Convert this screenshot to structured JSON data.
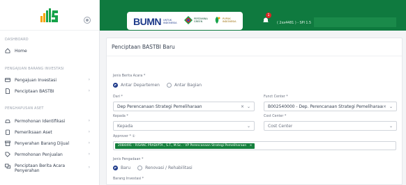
{
  "sidebar": {
    "sections": [
      {
        "label": "DASHBOARD"
      },
      {
        "label": "PENGAJUAN BARANG INVESTASI"
      },
      {
        "label": "PENGHAPUSAN ASET"
      }
    ],
    "items": {
      "home": "Home",
      "pengajuan_investasi": "Pengajuan Investasi",
      "penciptaan_bastbi": "Penciptaan BASTBI",
      "permohonan_identifikasi": "Permohonan Identifikasi",
      "pemeriksaan_aset": "Pemeriksaan Aset",
      "penyerahan_barang_dijual": "Penyerahan Barang Dijual",
      "permohonan_penjualan": "Permohonan Penjualan",
      "penciptaan_berita_acara": "Penciptaan Berita Acara Penyerahan"
    },
    "chevron": "›"
  },
  "topbar": {
    "banner": {
      "bumn": "BUMN",
      "bumn_sub": "UNTUK INDONESIA",
      "pertamina": "PERTAMINA GREEN",
      "pupuk": "PUPUK INDONESIA"
    },
    "notification_count": "1",
    "user_label": "( 2xx4481 ) - SPI 1.5"
  },
  "page": {
    "title": "Penciptaan BASTBI Baru",
    "jenis_label": "Jenis Berita Acara *",
    "jenis_options": [
      "Antar Departemen",
      "Antar Bagian"
    ],
    "dari_label": "Dari *",
    "dari_value": "Dep Perencanaan Strategi Pemeliharaan",
    "funct_label": "Funct Center *",
    "funct_value": "B002540000 - Dep. Perencanaan Strategi Pemeliharaan",
    "kepada_label": "Kepada *",
    "kepada_placeholder": "Kepada",
    "cost_label": "Cost Center *",
    "cost_placeholder": "Cost Center",
    "approver_label": "Approver * ①",
    "approver_tag": "2084491 - RISANC PRADIPTA , S.T., M.Sc. - VP Perencanaan Strategi Pemeliharaan",
    "tag_close": "×",
    "pengadaan_label": "Jenis Pengadaan *",
    "pengadaan_options": [
      "Baru",
      "Renovasi / Rehabilitasi"
    ],
    "barang_label": "Barang Investasi *"
  }
}
